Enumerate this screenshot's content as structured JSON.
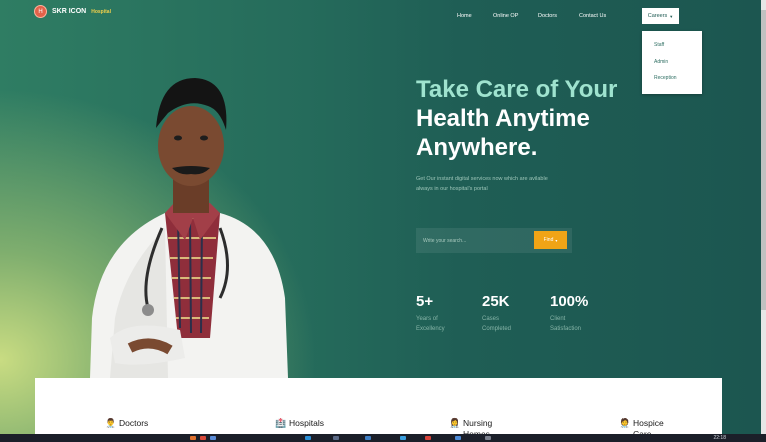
{
  "brand": {
    "logo_letter": "H",
    "name": "SKR ICON",
    "sub": "Hospital"
  },
  "nav": {
    "items": [
      "Home",
      "Online OP",
      "Doctors",
      "Contact Us"
    ],
    "careers": "Careers",
    "dropdown": [
      "Staff",
      "Admin",
      "Reception"
    ]
  },
  "hero": {
    "line1": "Take Care of Your",
    "line2": "Health Anytime",
    "line3": "Anywhere.",
    "sub1": "Get Our instant digital services now which are avilable",
    "sub2": "always in our hospital's portal",
    "search_placeholder": "Write your search...",
    "find_label": "Find",
    "stats": [
      {
        "value": "5+",
        "label1": "Years of",
        "label2": "Excellency"
      },
      {
        "value": "25K",
        "label1": "Cases",
        "label2": "Completed"
      },
      {
        "value": "100%",
        "label1": "Client",
        "label2": "Satisfaction"
      }
    ]
  },
  "cards": [
    {
      "label": "Doctors",
      "icon": "doctor-icon"
    },
    {
      "label": "Hospitals",
      "icon": "hospital-icon"
    },
    {
      "label": "Nursing Homes",
      "icon": "nurse-icon"
    },
    {
      "label": "Hospice Care",
      "icon": "hospice-icon"
    }
  ],
  "taskbar": {
    "clock": "22:18"
  },
  "colors": {
    "accent": "#9fe3cf",
    "button": "#f0a416",
    "brand_sub": "#f2d04a"
  }
}
